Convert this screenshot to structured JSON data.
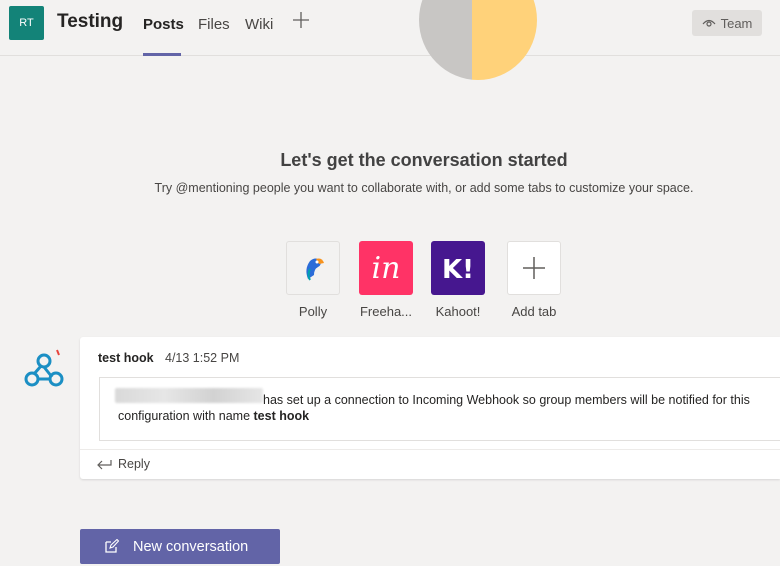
{
  "header": {
    "team_initials": "RT",
    "channel_name": "Testing",
    "tabs": [
      {
        "label": "Posts",
        "active": true
      },
      {
        "label": "Files",
        "active": false
      },
      {
        "label": "Wiki",
        "active": false
      }
    ],
    "add_tab_icon": "plus-icon",
    "team_button_label": "Team"
  },
  "welcome": {
    "title": "Let's get the conversation started",
    "subtitle": "Try @mentioning people you want to collaborate with, or add some tabs to customize your space."
  },
  "apps": [
    {
      "label": "Polly",
      "icon": "polly-parrot-icon",
      "color": "#f3f2f1"
    },
    {
      "label": "Freeha...",
      "icon": "invision-icon",
      "color": "#ff3366"
    },
    {
      "label": "Kahoot!",
      "icon": "kahoot-icon",
      "color": "#46178f"
    },
    {
      "label": "Add tab",
      "icon": "plus-icon",
      "color": "#f3f2f1"
    }
  ],
  "message": {
    "sender": "test hook",
    "time": "4/13 1:52 PM",
    "text_prefix": "has set up a connection to Incoming Webhook so group members will be notified for this configuration with name",
    "configuration_name": "test hook",
    "reply_label": "Reply"
  },
  "new_conversation_label": "New conversation",
  "colors": {
    "accent": "#6264a7",
    "team_avatar": "#138378",
    "webhook_icon": "#1b8fc4"
  }
}
